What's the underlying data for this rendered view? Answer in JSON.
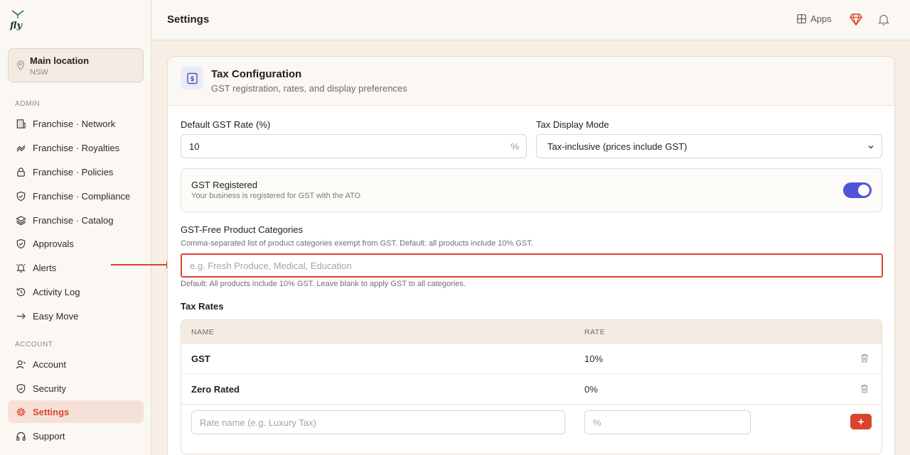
{
  "app": {
    "logo_text": "fly"
  },
  "location": {
    "name": "Main location",
    "region": "NSW"
  },
  "sidebar": {
    "admin_heading": "ADMIN",
    "admin_items": [
      {
        "label": "Franchise · Network",
        "icon": "building-icon"
      },
      {
        "label": "Franchise · Royalties",
        "icon": "royalties-icon"
      },
      {
        "label": "Franchise · Policies",
        "icon": "lock-icon"
      },
      {
        "label": "Franchise · Compliance",
        "icon": "shield-check-icon"
      },
      {
        "label": "Franchise · Catalog",
        "icon": "layers-icon"
      },
      {
        "label": "Approvals",
        "icon": "shield-check-icon"
      },
      {
        "label": "Alerts",
        "icon": "bell-ring-icon"
      },
      {
        "label": "Activity Log",
        "icon": "history-icon"
      },
      {
        "label": "Easy Move",
        "icon": "arrow-right-icon"
      }
    ],
    "account_heading": "ACCOUNT",
    "account_items": [
      {
        "label": "Account",
        "icon": "user-icon"
      },
      {
        "label": "Security",
        "icon": "shield-icon"
      },
      {
        "label": "Settings",
        "icon": "gear-icon",
        "active": true
      },
      {
        "label": "Support",
        "icon": "headphones-icon"
      }
    ]
  },
  "header": {
    "title": "Settings",
    "apps_label": "Apps"
  },
  "card": {
    "title": "Tax Configuration",
    "subtitle": "GST registration, rates, and display preferences"
  },
  "form": {
    "gst_rate_label": "Default GST Rate (%)",
    "gst_rate_value": "10",
    "gst_rate_suffix": "%",
    "display_mode_label": "Tax Display Mode",
    "display_mode_value": "Tax-inclusive (prices include GST)",
    "gst_registered_title": "GST Registered",
    "gst_registered_desc": "Your business is registered for GST with the ATO",
    "gst_registered_on": true,
    "gst_free_label": "GST-Free Product Categories",
    "gst_free_help": "Comma-separated list of product categories exempt from GST. Default: all products include 10% GST.",
    "gst_free_placeholder": "e.g. Fresh Produce, Medical, Education",
    "gst_free_note": "Default: All products include 10% GST. Leave blank to apply GST to all categories."
  },
  "tax_rates": {
    "heading": "Tax Rates",
    "columns": [
      "NAME",
      "RATE"
    ],
    "rows": [
      {
        "name": "GST",
        "rate": "10%"
      },
      {
        "name": "Zero Rated",
        "rate": "0%"
      }
    ],
    "new_name_placeholder": "Rate name (e.g. Luxury Tax)",
    "new_rate_placeholder": "%",
    "add_label": "+"
  },
  "colors": {
    "accent": "#d9442b",
    "toggle": "#4f55d8",
    "background": "#f7efe6"
  }
}
